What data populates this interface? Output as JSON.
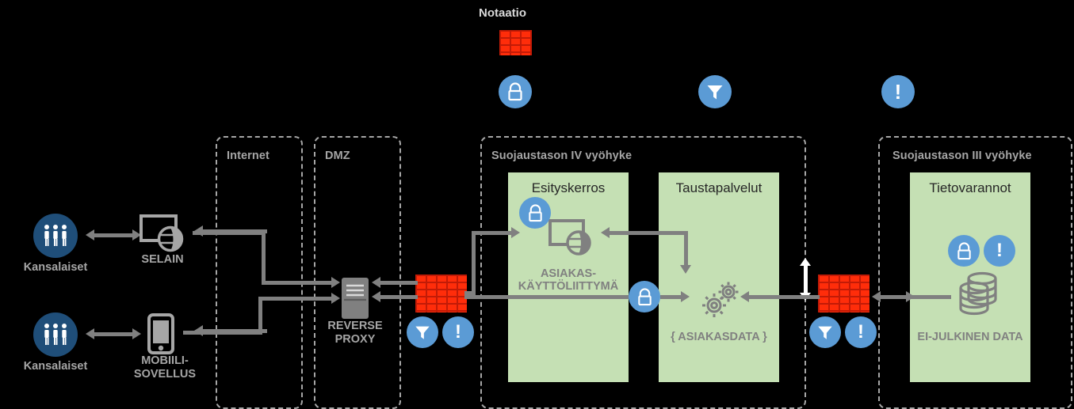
{
  "diagram": {
    "title": "Notaatio",
    "background_color": "#000000",
    "zone_color": "#a6a6a6",
    "box_color": "#c5e0b4",
    "badge_color": "#5b9bd5",
    "firewall_color": "#ff2d0a",
    "people_color": "#1f4e79",
    "connector_color": "#808080"
  },
  "notation": {
    "title": "Notaatio",
    "items": [
      {
        "icon": "firewall-icon",
        "label": ""
      },
      {
        "icon": "lock-icon",
        "label": ""
      },
      {
        "icon": "filter-icon",
        "label": ""
      },
      {
        "icon": "exclamation-icon",
        "label": ""
      }
    ]
  },
  "zones": [
    {
      "label": "Internet"
    },
    {
      "label": "DMZ"
    },
    {
      "label": "Suojaustason IV vyöhyke"
    },
    {
      "label": "Suojaustason III vyöhyke"
    }
  ],
  "actors": [
    {
      "label": "Kansalaiset",
      "icon": "people-icon"
    },
    {
      "label": "Kansalaiset",
      "icon": "people-icon"
    }
  ],
  "clients": [
    {
      "label": "SELAIN",
      "icon": "browser-icon"
    },
    {
      "label": "MOBIILI-\nSOVELLUS",
      "icon": "mobile-icon"
    }
  ],
  "dmz": {
    "node_label": "REVERSE\nPROXY",
    "node_icon": "server-icon"
  },
  "boxes": [
    {
      "title": "Esityskerros",
      "caption": "ASIAKAS-\nKÄYTTÖLIITTYMÄ",
      "icon": "browser-globe-icon",
      "badges": [
        "lock-icon"
      ]
    },
    {
      "title": "Taustapalvelut",
      "caption": "{ ASIAKASDATA }",
      "icon": "gears-icon",
      "badges": []
    },
    {
      "title": "Tietovarannot",
      "caption": "EI-JULKINEN\nDATA",
      "icon": "database-icon",
      "badges": [
        "lock-icon",
        "exclamation-icon"
      ]
    }
  ],
  "firewalls": [
    {
      "name": "firewall-dmz",
      "badges": [
        "filter-icon",
        "exclamation-icon"
      ]
    },
    {
      "name": "firewall-backend",
      "badges": [
        "filter-icon",
        "exclamation-icon"
      ]
    }
  ],
  "inline_badges": [
    {
      "name": "lock-badge-presentation",
      "icon": "lock-icon"
    },
    {
      "name": "lock-badge-backend",
      "icon": "lock-icon"
    }
  ],
  "glyphs": {
    "exclamation": "!"
  }
}
